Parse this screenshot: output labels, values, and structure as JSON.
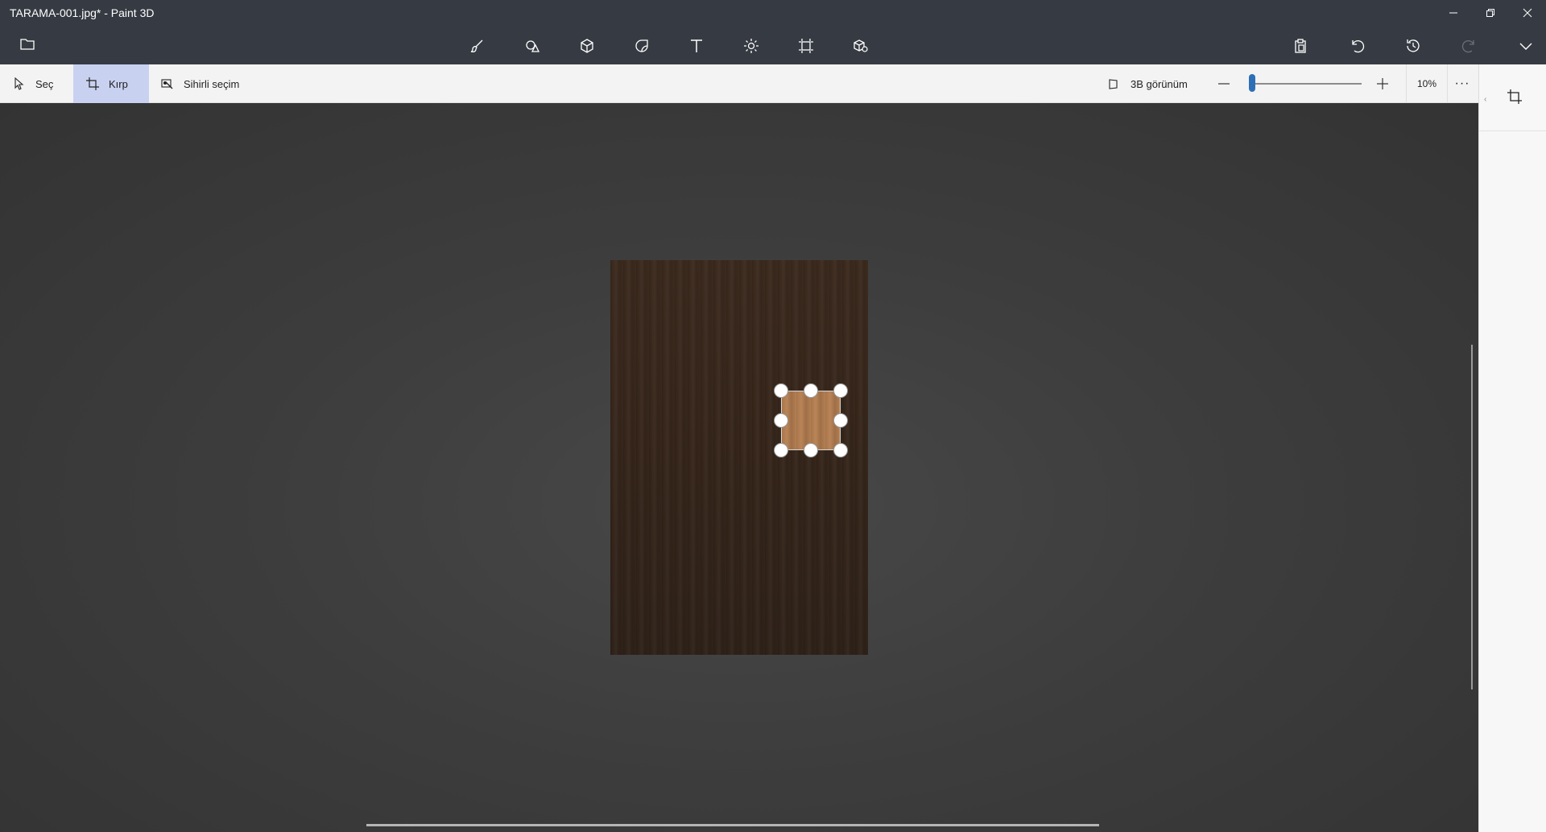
{
  "window": {
    "title": "TARAMA-001.jpg* - Paint 3D"
  },
  "toolbar": {
    "tools": [
      "brushes",
      "2d-shapes",
      "3d-shapes",
      "stickers",
      "text",
      "effects",
      "canvas",
      "3d-library"
    ],
    "right": [
      "paste",
      "undo",
      "history",
      "redo",
      "expand"
    ]
  },
  "subbar": {
    "select_label": "Seç",
    "crop_label": "Kırp",
    "magic_label": "Sihirli seçim",
    "view3d_label": "3B görünüm",
    "zoom_value": "10%",
    "zoom_fraction": 0.02,
    "more_label": "···"
  },
  "colors": {
    "titlebar": "#363b43",
    "accent": "#2d6fb6",
    "crop_highlight": "#c8d1f0"
  }
}
